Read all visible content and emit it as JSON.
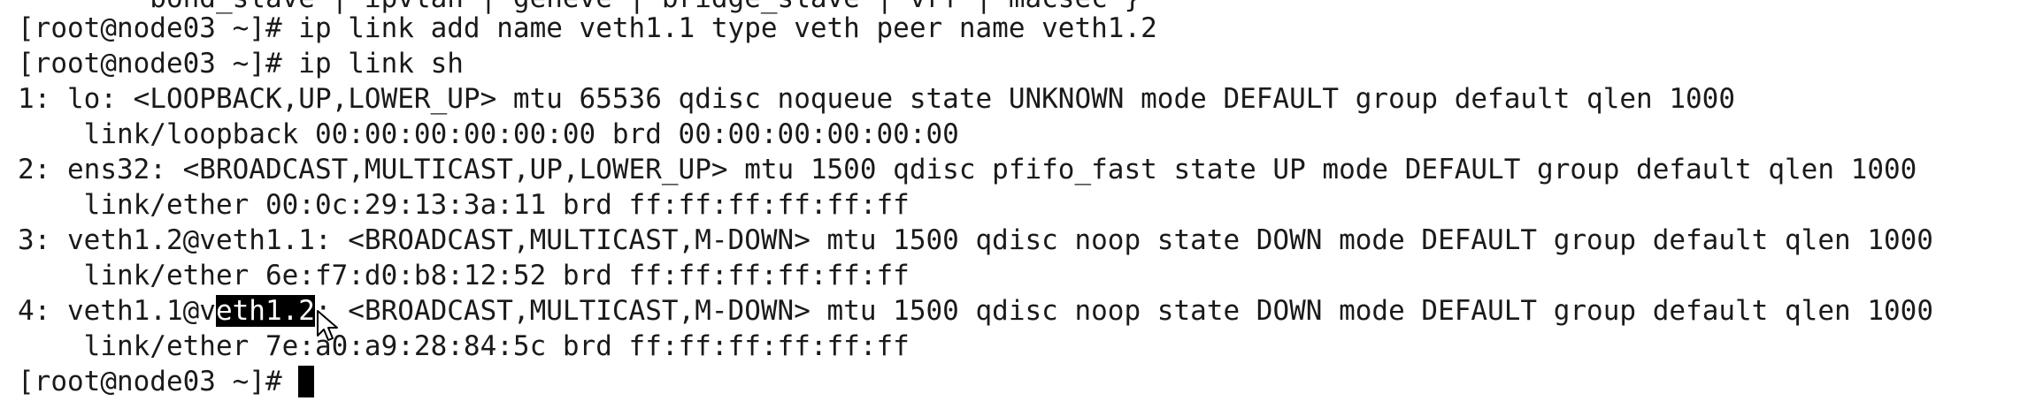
{
  "terminal": {
    "lines": {
      "0": "        bond_slave | ipvlan | geneve | bridge_slave | vrf | macsec }",
      "1": "[root@node03 ~]# ip link add name veth1.1 type veth peer name veth1.2",
      "2": "[root@node03 ~]# ip link sh",
      "3": "1: lo: <LOOPBACK,UP,LOWER_UP> mtu 65536 qdisc noqueue state UNKNOWN mode DEFAULT group default qlen 1000",
      "4": "    link/loopback 00:00:00:00:00:00 brd 00:00:00:00:00:00",
      "5": "2: ens32: <BROADCAST,MULTICAST,UP,LOWER_UP> mtu 1500 qdisc pfifo_fast state UP mode DEFAULT group default qlen 1000",
      "6": "    link/ether 00:0c:29:13:3a:11 brd ff:ff:ff:ff:ff:ff",
      "7": "3: veth1.2@veth1.1: <BROADCAST,MULTICAST,M-DOWN> mtu 1500 qdisc noop state DOWN mode DEFAULT group default qlen 1000",
      "8": "    link/ether 6e:f7:d0:b8:12:52 brd ff:ff:ff:ff:ff:ff",
      "9": {
        "before": "4: veth1.1@v",
        "selected": "eth1.2",
        "after": ": <BROADCAST,MULTICAST,M-DOWN> mtu 1500 qdisc noop state DOWN mode DEFAULT group default qlen 1000"
      },
      "10": "    link/ether 7e:a0:a9:28:84:5c brd ff:ff:ff:ff:ff:ff",
      "11": "[root@node03 ~]# "
    }
  },
  "colors": {
    "background": "#ffffff",
    "text": "#1a1a1a",
    "selection_bg": "#000000",
    "selection_fg": "#ffffff",
    "cursor": "#000000"
  },
  "icons": {
    "mouse_pointer": "arrow-pointer-icon",
    "text_cursor": "block-cursor-icon"
  }
}
